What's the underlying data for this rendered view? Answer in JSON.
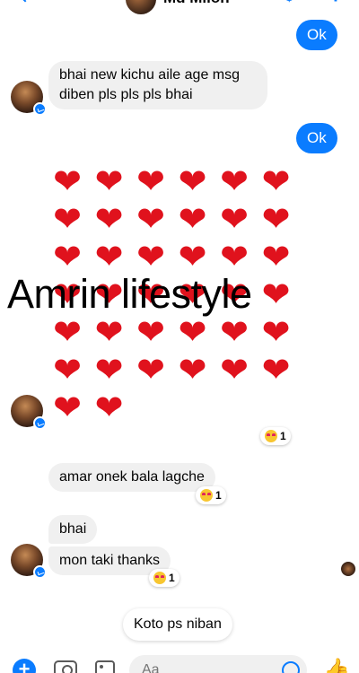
{
  "header": {
    "contact_name": "Md Milon",
    "call_icon": "$"
  },
  "messages": [
    {
      "type": "outgoing",
      "text": "Ok"
    },
    {
      "type": "incoming",
      "text": "bhai new kichu aile age msg diben pls pls pls bhai"
    },
    {
      "type": "outgoing",
      "text": "Ok"
    },
    {
      "type": "incoming-emoji",
      "content": "hearts",
      "count": 38
    },
    {
      "type": "incoming",
      "text": "amar onek bala lagche",
      "reaction": {
        "emoji": "heart-eyes",
        "count": "1"
      }
    },
    {
      "type": "incoming",
      "text": "bhai"
    },
    {
      "type": "incoming",
      "text": "mon taki thanks",
      "reaction": {
        "emoji": "heart-eyes",
        "count": "1"
      }
    }
  ],
  "heart_reaction": {
    "emoji": "heart-eyes",
    "count": "1"
  },
  "watermark": "Amrin lifestyle",
  "suggestion": "Koto ps niban",
  "composer": {
    "placeholder": "Aa"
  },
  "icons": {
    "heart": "❤",
    "like": "👍"
  },
  "colors": {
    "accent": "#0a7cff",
    "incoming_bubble": "#f0f0f0",
    "heart": "#e0121d"
  }
}
